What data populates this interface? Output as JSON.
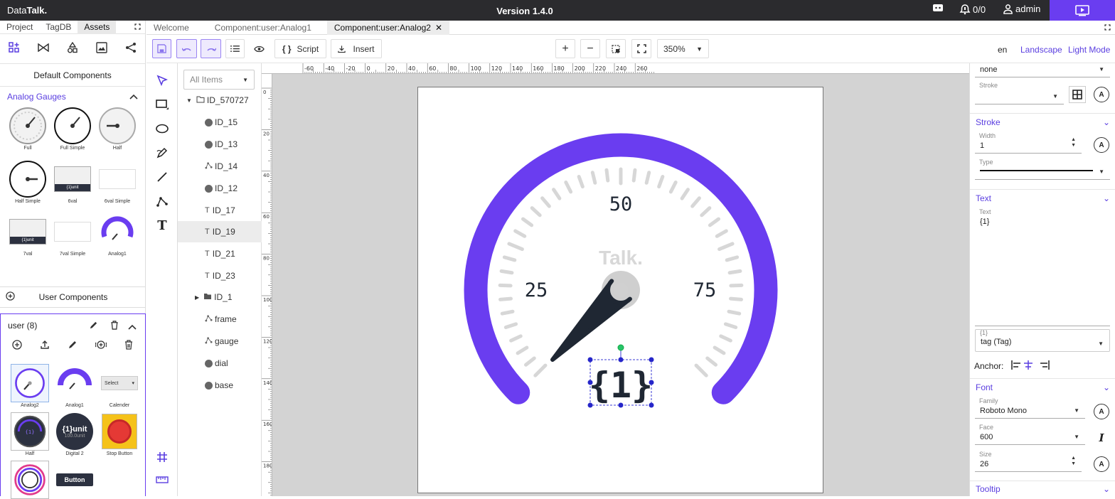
{
  "app": {
    "brand_plain": "Data",
    "brand_bold": "Talk.",
    "version": "Version 1.4.0",
    "alarm_count": "0/0",
    "user": "admin"
  },
  "left": {
    "tabs": [
      "Project",
      "TagDB",
      "Assets"
    ],
    "default_title": "Default Components",
    "category": "Analog Gauges",
    "gauges": [
      "Full",
      "Full Simple",
      "Half",
      "Half Simple",
      "6val",
      "6val Simple",
      "7val",
      "7val Simple",
      "Analog1"
    ],
    "user_title": "User Components",
    "user_group": "user (8)",
    "user_items": [
      "Analog2",
      "Analog1",
      "Calender",
      "Half",
      "Digital 2",
      "Stop Button"
    ],
    "thumb_texts": {
      "unit": "{1}unit",
      "unit2": "100.0unit",
      "select": "Select",
      "button": "Button",
      "one": "{1}"
    }
  },
  "doctabs": [
    "Welcome",
    "Component:user:Analog1",
    "Component:user:Analog2"
  ],
  "toolbar": {
    "script": "Script",
    "insert": "Insert",
    "zoom": "350%",
    "lang": "en",
    "orientation": "Landscape",
    "theme": "Light Mode"
  },
  "tree": {
    "filter": "All Items",
    "items": [
      "ID_570727",
      "ID_15",
      "ID_13",
      "ID_14",
      "ID_12",
      "ID_17",
      "ID_19",
      "ID_21",
      "ID_23",
      "ID_1",
      "frame",
      "gauge",
      "dial",
      "base"
    ]
  },
  "ruler": {
    "h": [
      "-60",
      "-40",
      "-20",
      "0",
      "20",
      "40",
      "60",
      "80",
      "100",
      "120",
      "140",
      "160",
      "180",
      "200",
      "220",
      "240",
      "260"
    ],
    "v": [
      "0",
      "20",
      "40",
      "60",
      "80",
      "100",
      "120",
      "140",
      "160",
      "180"
    ]
  },
  "gauge": {
    "labels": [
      "25",
      "50",
      "75"
    ],
    "watermark": "Talk.",
    "text": "{1}",
    "accent": "#6a3df0",
    "needle": "#1f2733"
  },
  "props": {
    "fill_value": "none",
    "stroke_label": "Stroke",
    "stroke_section": "Stroke",
    "width_label": "Width",
    "width_value": "1",
    "type_label": "Type",
    "text_section": "Text",
    "text_label": "Text",
    "text_value": "{1}",
    "param_label": "{1}",
    "param_value": "tag (Tag)",
    "anchor": "Anchor:",
    "font_section": "Font",
    "family_label": "Family",
    "family_value": "Roboto Mono",
    "face_label": "Face",
    "face_value": "600",
    "size_label": "Size",
    "size_value": "26",
    "tooltip_section": "Tooltip"
  }
}
